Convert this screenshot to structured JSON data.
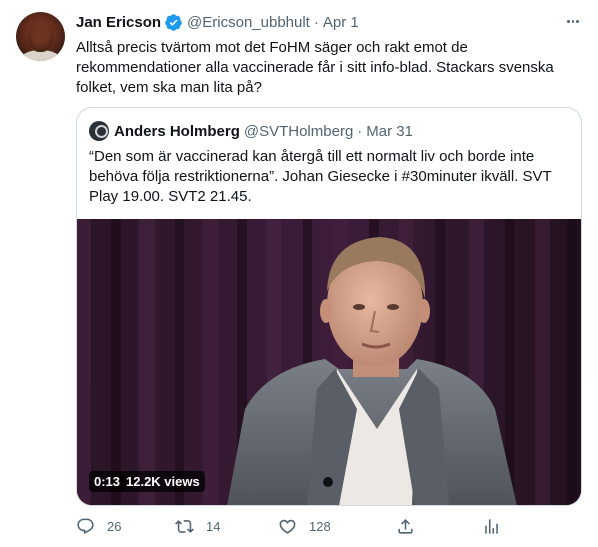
{
  "tweet": {
    "author_name": "Jan Ericson",
    "author_handle": "@Ericson_ubbhult",
    "separator": "·",
    "date": "Apr 1",
    "text": "Alltså precis tvärtom mot det FoHM säger och rakt emot de\nrekommendationer alla vaccinerade får i sitt info-blad. Stackars svenska\nfolket, vem ska man lita på?",
    "verified": true
  },
  "quoted_tweet": {
    "author_name": "Anders Holmberg",
    "author_handle": "@SVTHolmberg",
    "separator": "·",
    "date": "Mar 31",
    "text": "“Den som är vaccinerad kan återgå till ett normalt liv och borde inte\nbehöva följa restriktionerna”. Johan Giesecke i #30minuter ikväll. SVT\nPlay 19.00. SVT2 21.45.",
    "video": {
      "time": "0:13",
      "views": "12.2K views"
    }
  },
  "actions": {
    "reply_count": "26",
    "retweet_count": "14",
    "like_count": "128"
  },
  "icons": {
    "more": "more-icon",
    "verified": "verified-badge-icon",
    "reply": "reply-icon",
    "retweet": "retweet-icon",
    "like": "heart-icon",
    "share": "share-icon",
    "stats": "analytics-icon"
  },
  "colors": {
    "text_primary": "#0f1419",
    "text_secondary": "#536471",
    "verified_blue": "#1d9bf0",
    "border": "#cfd9de"
  }
}
